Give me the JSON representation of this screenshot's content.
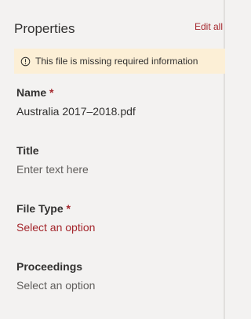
{
  "panel": {
    "title": "Properties",
    "edit_all_label": "Edit all"
  },
  "warning": {
    "icon": "info-circle-icon",
    "text": "This file is missing required information"
  },
  "fields": [
    {
      "label": "Name",
      "required_marker": "*",
      "value": "Australia 2017–2018.pdf"
    },
    {
      "label": "Title",
      "placeholder": "Enter text here"
    },
    {
      "label": "File Type",
      "required_marker": "*",
      "placeholder": "Select an option"
    },
    {
      "label": "Proceedings",
      "placeholder": "Select an option"
    }
  ],
  "colors": {
    "background": "#f3f2f1",
    "required_accent": "#a4262c",
    "warning_background": "#fcefd6",
    "text": "#323130",
    "placeholder_text": "#605e5c"
  }
}
